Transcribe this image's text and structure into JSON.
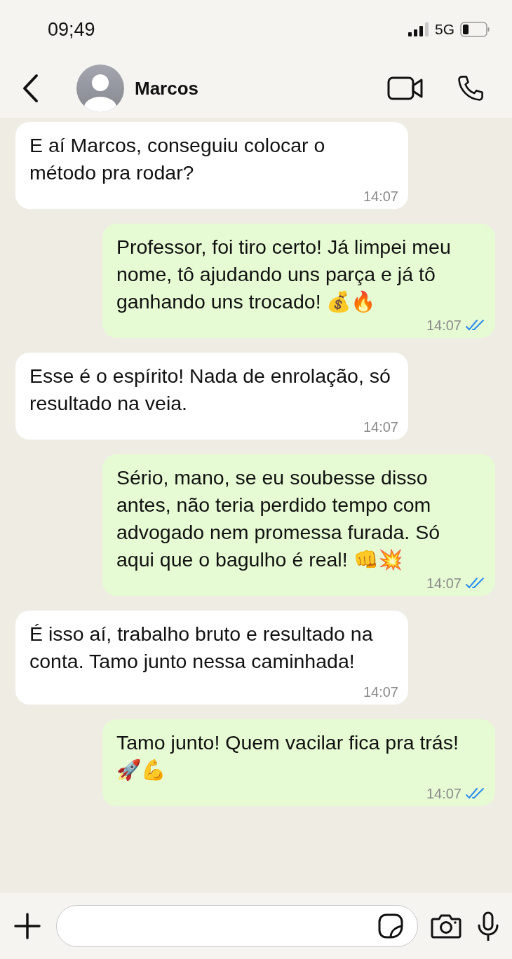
{
  "status_bar": {
    "time": "09;49",
    "network": "5G"
  },
  "header": {
    "contact_name": "Marcos"
  },
  "messages": [
    {
      "kind": "received",
      "text": "E aí Marcos, conseguiu colocar o método pra rodar?",
      "time": "14:07"
    },
    {
      "kind": "sent",
      "text": "Professor, foi tiro certo! Já limpei meu nome, tô ajudando uns parça e já tô ganhando uns trocado! 💰🔥",
      "time": "14:07",
      "read": true
    },
    {
      "kind": "received",
      "text": "Esse é o espírito! Nada de enrolação, só resultado na veia.",
      "time": "14:07"
    },
    {
      "kind": "sent",
      "text": "Sério, mano, se eu soubesse disso antes, não teria perdido tempo com advogado nem promessa furada. Só aqui que o bagulho é real! 👊💥",
      "time": "14:07",
      "read": true
    },
    {
      "kind": "received",
      "text": "É isso aí, trabalho bruto e resultado na conta. Tamo junto nessa caminhada!",
      "time": "14:07",
      "time_on_own_line": true
    },
    {
      "kind": "sent",
      "text": "Tamo junto! Quem vacilar fica pra trás! 🚀💪",
      "time": "14:07",
      "read": true
    }
  ]
}
